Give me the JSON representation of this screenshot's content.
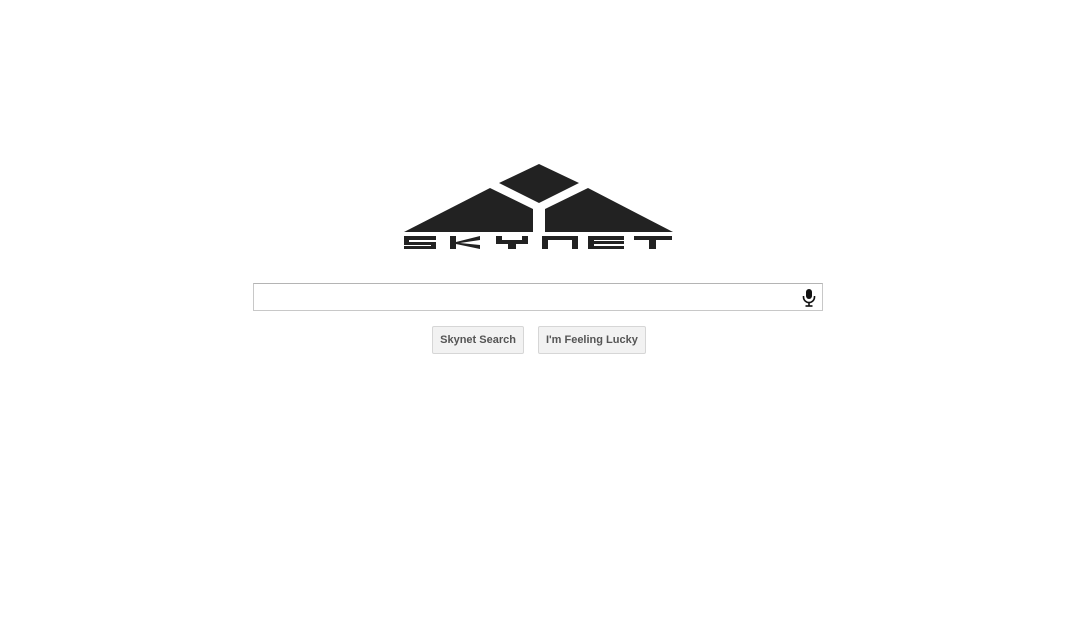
{
  "logo": {
    "text": "skynet",
    "color": "#222222"
  },
  "search": {
    "value": "",
    "placeholder": "",
    "mic_icon": "microphone-icon"
  },
  "buttons": {
    "search_label": "Skynet Search",
    "lucky_label": "I'm Feeling Lucky"
  }
}
